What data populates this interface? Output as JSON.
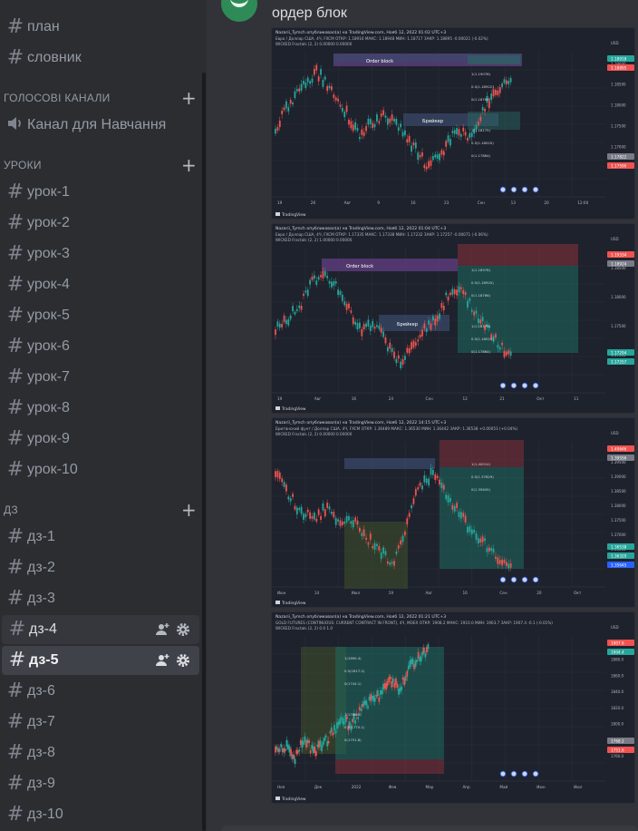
{
  "sidebar": {
    "top_channels": [
      {
        "label": "план"
      },
      {
        "label": "словник"
      }
    ],
    "voice_category": {
      "label": "ГОЛОСОВІ КАНАЛИ"
    },
    "voice_channels": [
      {
        "label": "Канал для Навчання"
      }
    ],
    "lessons_category": {
      "label": "УРОКИ"
    },
    "lessons": [
      {
        "label": "урок-1"
      },
      {
        "label": "урок-2"
      },
      {
        "label": "урок-3"
      },
      {
        "label": "урок-4"
      },
      {
        "label": "урок-5"
      },
      {
        "label": "урок-6"
      },
      {
        "label": "урок-7"
      },
      {
        "label": "урок-8"
      },
      {
        "label": "урок-9"
      },
      {
        "label": "урок-10"
      }
    ],
    "homework_category": {
      "label": "ДЗ"
    },
    "homework": [
      {
        "label": "дз-1"
      },
      {
        "label": "дз-2"
      },
      {
        "label": "дз-3"
      },
      {
        "label": "дз-4"
      },
      {
        "label": "дз-5"
      },
      {
        "label": "дз-6"
      },
      {
        "label": "дз-7"
      },
      {
        "label": "дз-8"
      },
      {
        "label": "дз-9"
      },
      {
        "label": "дз-10"
      }
    ]
  },
  "message": {
    "text": "ордер блок"
  },
  "charts": [
    {
      "header": "Nazarii_Tymch опубликовал(а) на TradingView.com, Нояб 12, 2022 01:02 UTC+3",
      "symbol": "Евро / Доллар США, 4Ч, FXCM  ОТКР: 1.18916  МАКС: 1.18948  МИН: 1.18717  ЗАКР: 1.18895 -0.00021 (-0.02%)",
      "indicator": "WICKED Fractals (2, 2)  0.00000  0.00000",
      "labels": [
        "Order block",
        "Брейкер"
      ],
      "fib": [
        "1(1.19078)",
        "0.5(1.18922)",
        "0(1.18766)",
        "1(1.18175)",
        "0.5(1.18020)",
        "0(1.17864)"
      ],
      "price_tags": [
        "1.18918",
        "1.18895",
        "1.17822",
        "1.17590"
      ],
      "y_ticks": [
        "USD",
        "1.19000",
        "1.18500",
        "1.18000",
        "1.17500",
        "1.17000",
        "1.16500"
      ],
      "x_ticks": [
        "19",
        "26",
        "Авг",
        "9",
        "16",
        "23",
        "Сен",
        "13",
        "20",
        "12:00"
      ],
      "brand": "TradingView"
    },
    {
      "header": "Nazarii_Tymch опубликовал(а) на TradingView.com, Нояб 12, 2022 01:04 UTC+3",
      "symbol": "Евро / Доллар США, 4Ч, FXCM  ОТКР: 1.17335  МАКС: 1.17338  МИН: 1.17232  ЗАКР: 1.17257 -0.00071 (-0.06%)",
      "indicator": "WICKED Fractals (2, 2)  1.00000  0.00000",
      "labels": [
        "Order block",
        "Брейкер"
      ],
      "fib": [
        "1(1.18978)",
        "0.5(1.18920)",
        "0(1.18766)",
        "1(1.18175)",
        "0.5(1.18020)",
        "0(1.17864)"
      ],
      "price_tags": [
        "1.19334",
        "1.18924",
        "1.17294",
        "1.17257"
      ],
      "y_ticks": [
        "USD",
        "1.18500",
        "1.18000",
        "1.17500",
        "1.17000"
      ],
      "x_ticks": [
        "19",
        "Авг",
        "16",
        "24",
        "Сен",
        "12",
        "21",
        "Окт",
        "11"
      ],
      "brand": "TradingView"
    },
    {
      "header": "Nazarii_Tymch опубликовал(а) на TradingView.com, Нояб 12, 2022 14:15 UTC+3",
      "symbol": "Британский фунт / Доллар США, 4Ч, FXCM  ОТКР: 1.36489  МАКС: 1.36530  МИН: 1.36442  ЗАКР: 1.36538 +0.00053 (+0.04%)",
      "indicator": "WICKED Fractals (2, 2)  0.00000  0.00000",
      "fib": [
        "1(1.40014)",
        "0.5(1.37829)",
        "0(1.35645)"
      ],
      "price_tags": [
        "1.40646",
        "1.39556",
        "1.36538",
        "1.36329",
        "1.35645"
      ],
      "y_ticks": [
        "USD",
        "1.40000",
        "1.39500",
        "1.39000",
        "1.38500",
        "1.38000",
        "1.37500",
        "1.37000",
        "1.36500",
        "1.36000"
      ],
      "x_ticks": [
        "Июн",
        "14",
        "Июл",
        "19",
        "Авг",
        "16",
        "Сен",
        "20",
        "Окт"
      ],
      "brand": "TradingView"
    },
    {
      "header": "Nazarii_Tymch опубликовал(а) на TradingView.com, Нояб 12, 2022 01:21 UTC+3",
      "symbol": "GOLD FUTURES (CONTINUOUS: CURRENT CONTRACT IN FRONT), 4Ч, MOEX  ОТКР: 1908.2  МАКС: 1910.0  МИН: 1903.7  ЗАКР: 1907.4 -0.1 (-0.01%)",
      "indicator": "WICKED Fractals (2, 2)  0.0  1.0",
      "fib": [
        "1(1890.4)",
        "0.5(1817.2)",
        "0(1744.1)",
        "1(1788.9)",
        "0.5(1770.1)",
        "0(1751.8)"
      ],
      "price_tags": [
        "1907.6",
        "1904.4",
        "1768.2",
        "1751.6"
      ],
      "y_ticks": [
        "USD",
        "apoc",
        "1880.0",
        "1860.0",
        "1840.0",
        "1820.0",
        "1800.0",
        "1780.0",
        "1760.0"
      ],
      "x_ticks": [
        "Ноя",
        "Дек",
        "2022",
        "Фев",
        "Мар",
        "Апр",
        "Май",
        "Июн",
        "Июл"
      ],
      "brand": "TradingView"
    }
  ],
  "colors": {
    "sidebar_bg": "#2b2d31",
    "main_bg": "#313338",
    "active_bg": "#404249",
    "chart_bg": "#1e222d",
    "bull": "#26a69a",
    "bear": "#ef5350",
    "zone_purple": "#5b3b7a",
    "zone_blue": "#3a4a6b"
  }
}
